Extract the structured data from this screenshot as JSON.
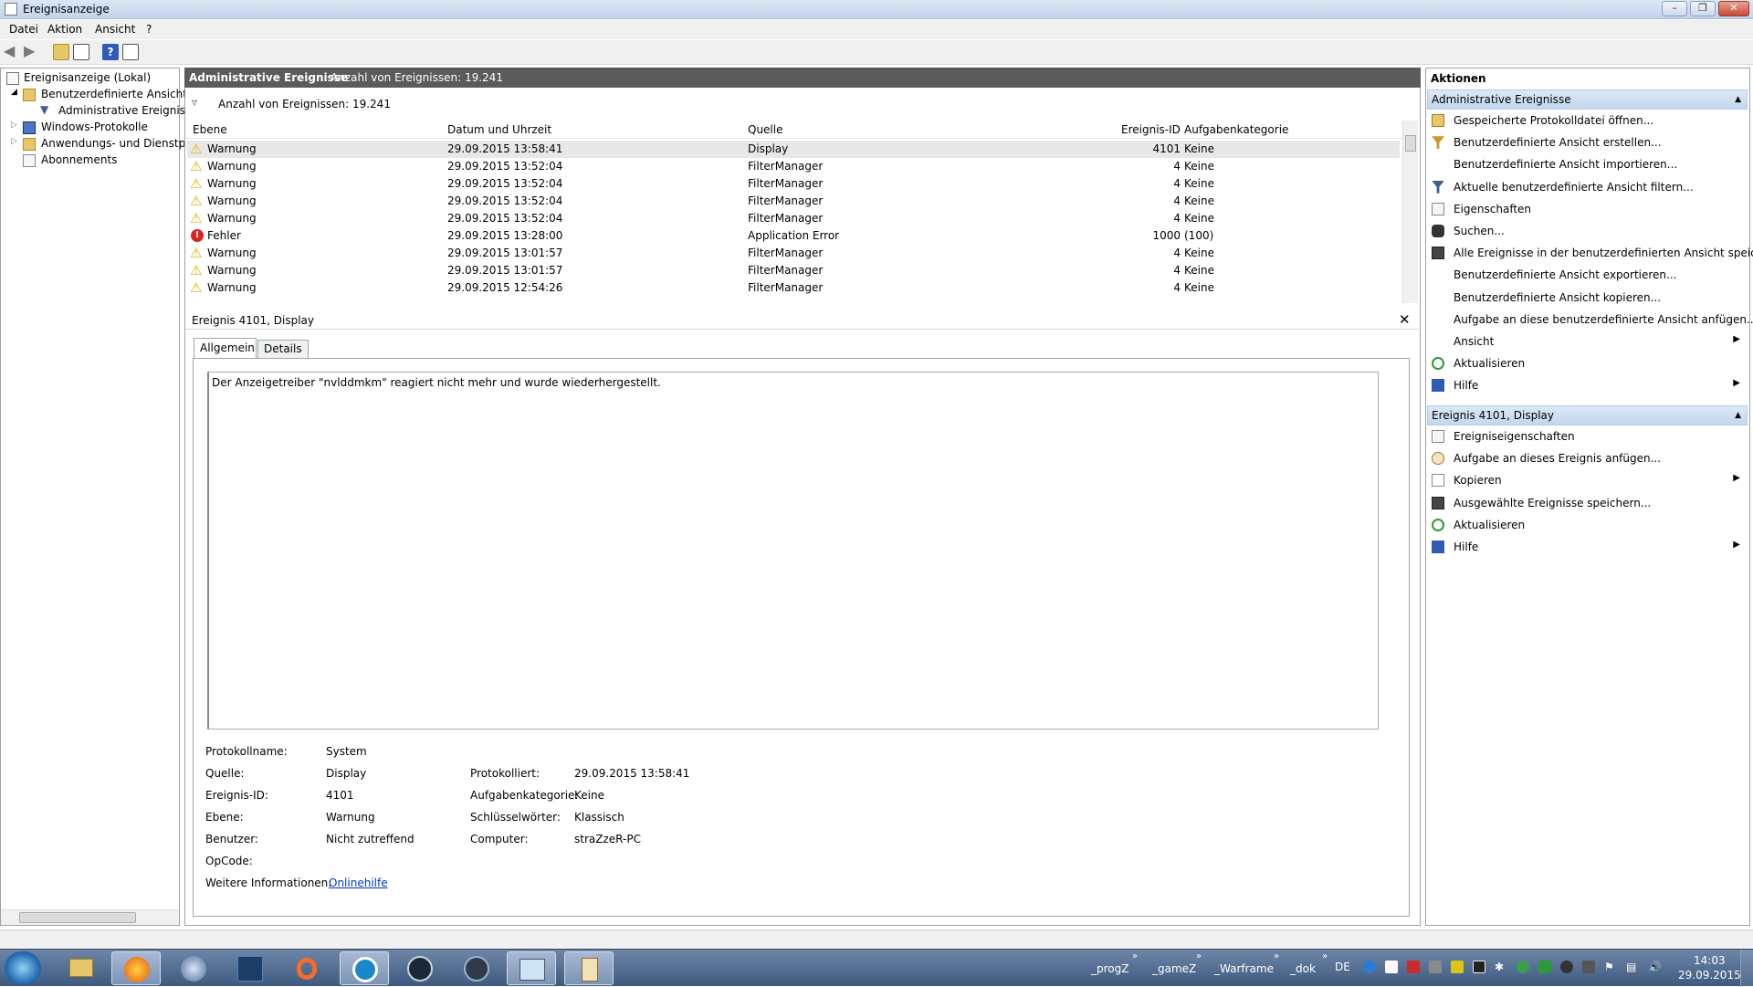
{
  "window": {
    "title": "Ereignisanzeige"
  },
  "menu": [
    "Datei",
    "Aktion",
    "Ansicht",
    "?"
  ],
  "tree": {
    "root": "Ereignisanzeige (Lokal)",
    "custom_views": "Benutzerdefinierte Ansichten",
    "admin_events": "Administrative Ereignisse",
    "windows_logs": "Windows-Protokolle",
    "app_logs": "Anwendungs- und Dienstpro",
    "subscriptions": "Abonnements"
  },
  "header": {
    "title": "Administrative Ereignisse",
    "count": "Anzahl von Ereignissen: 19.241"
  },
  "filter": {
    "text": "Anzahl von Ereignissen: 19.241"
  },
  "columns": [
    "Ebene",
    "Datum und Uhrzeit",
    "Quelle",
    "Ereignis-ID",
    "Aufgabenkategorie"
  ],
  "rows": [
    {
      "level": "Warnung",
      "type": "warning",
      "date": "29.09.2015 13:58:41",
      "source": "Display",
      "id": "4101",
      "cat": "Keine"
    },
    {
      "level": "Warnung",
      "type": "warning",
      "date": "29.09.2015 13:52:04",
      "source": "FilterManager",
      "id": "4",
      "cat": "Keine"
    },
    {
      "level": "Warnung",
      "type": "warning",
      "date": "29.09.2015 13:52:04",
      "source": "FilterManager",
      "id": "4",
      "cat": "Keine"
    },
    {
      "level": "Warnung",
      "type": "warning",
      "date": "29.09.2015 13:52:04",
      "source": "FilterManager",
      "id": "4",
      "cat": "Keine"
    },
    {
      "level": "Warnung",
      "type": "warning",
      "date": "29.09.2015 13:52:04",
      "source": "FilterManager",
      "id": "4",
      "cat": "Keine"
    },
    {
      "level": "Fehler",
      "type": "error",
      "date": "29.09.2015 13:28:00",
      "source": "Application Error",
      "id": "1000",
      "cat": "(100)"
    },
    {
      "level": "Warnung",
      "type": "warning",
      "date": "29.09.2015 13:01:57",
      "source": "FilterManager",
      "id": "4",
      "cat": "Keine"
    },
    {
      "level": "Warnung",
      "type": "warning",
      "date": "29.09.2015 13:01:57",
      "source": "FilterManager",
      "id": "4",
      "cat": "Keine"
    },
    {
      "level": "Warnung",
      "type": "warning",
      "date": "29.09.2015 12:54:26",
      "source": "FilterManager",
      "id": "4",
      "cat": "Keine"
    }
  ],
  "detail": {
    "title": "Ereignis 4101, Display",
    "tabs": [
      "Allgemein",
      "Details"
    ],
    "message": "Der Anzeigetreiber \"nvlddmkm\" reagiert nicht mehr und wurde wiederhergestellt.",
    "labels": {
      "log_name": "Protokollname:",
      "source": "Quelle:",
      "event_id": "Ereignis-ID:",
      "level": "Ebene:",
      "user": "Benutzer:",
      "opcode": "OpCode:",
      "more_info": "Weitere Informationen:",
      "logged": "Protokolliert:",
      "task_cat": "Aufgabenkategorie:",
      "keywords": "Schlüsselwörter:",
      "computer": "Computer:"
    },
    "values": {
      "log_name": "System",
      "source": "Display",
      "event_id": "4101",
      "level": "Warnung",
      "user": "Nicht zutreffend",
      "opcode": "",
      "more_info": "Onlinehilfe",
      "logged": "29.09.2015 13:58:41",
      "task_cat": "Keine",
      "keywords": "Klassisch",
      "computer": "straZzeR-PC"
    }
  },
  "actions": {
    "title": "Aktionen",
    "section1": "Administrative Ereignisse",
    "items1": [
      {
        "label": "Gespeicherte Protokolldatei öffnen...",
        "icon": "folder-open-icon",
        "submenu": false
      },
      {
        "label": "Benutzerdefinierte Ansicht erstellen...",
        "icon": "filter-create-icon",
        "submenu": false
      },
      {
        "label": "Benutzerdefinierte Ansicht importieren...",
        "icon": "",
        "submenu": false
      },
      {
        "label": "Aktuelle benutzerdefinierte Ansicht filtern...",
        "icon": "filter-icon",
        "submenu": false
      },
      {
        "label": "Eigenschaften",
        "icon": "properties-icon",
        "submenu": false
      },
      {
        "label": "Suchen...",
        "icon": "binoculars-icon",
        "submenu": false
      },
      {
        "label": "Alle Ereignisse in der benutzerdefinierten Ansicht speic...",
        "icon": "save-icon",
        "submenu": false
      },
      {
        "label": "Benutzerdefinierte Ansicht exportieren...",
        "icon": "",
        "submenu": false
      },
      {
        "label": "Benutzerdefinierte Ansicht kopieren...",
        "icon": "",
        "submenu": false
      },
      {
        "label": "Aufgabe an diese benutzerdefinierte Ansicht anfügen...",
        "icon": "",
        "submenu": false
      },
      {
        "label": "Ansicht",
        "icon": "",
        "submenu": true
      },
      {
        "label": "Aktualisieren",
        "icon": "refresh-icon",
        "submenu": false
      },
      {
        "label": "Hilfe",
        "icon": "help-icon",
        "submenu": true
      }
    ],
    "section2": "Ereignis 4101, Display",
    "items2": [
      {
        "label": "Ereigniseigenschaften",
        "icon": "event-properties-icon",
        "submenu": false
      },
      {
        "label": "Aufgabe an dieses Ereignis anfügen...",
        "icon": "task-icon",
        "submenu": false
      },
      {
        "label": "Kopieren",
        "icon": "copy-icon",
        "submenu": true
      },
      {
        "label": "Ausgewählte Ereignisse speichern...",
        "icon": "save-icon",
        "submenu": false
      },
      {
        "label": "Aktualisieren",
        "icon": "refresh-icon",
        "submenu": false
      },
      {
        "label": "Hilfe",
        "icon": "help-icon",
        "submenu": true
      }
    ]
  },
  "taskbar": {
    "toolbars": [
      "_progZ",
      "_gameZ",
      "_Warframe",
      "_dok"
    ],
    "lang": "DE",
    "time": "14:03",
    "date": "29.09.2015"
  },
  "colors": {
    "header_bg": "#5b5b5b",
    "section_bg": "#c4d7ee",
    "taskbar": "#4a6690",
    "link": "#0033cc"
  }
}
